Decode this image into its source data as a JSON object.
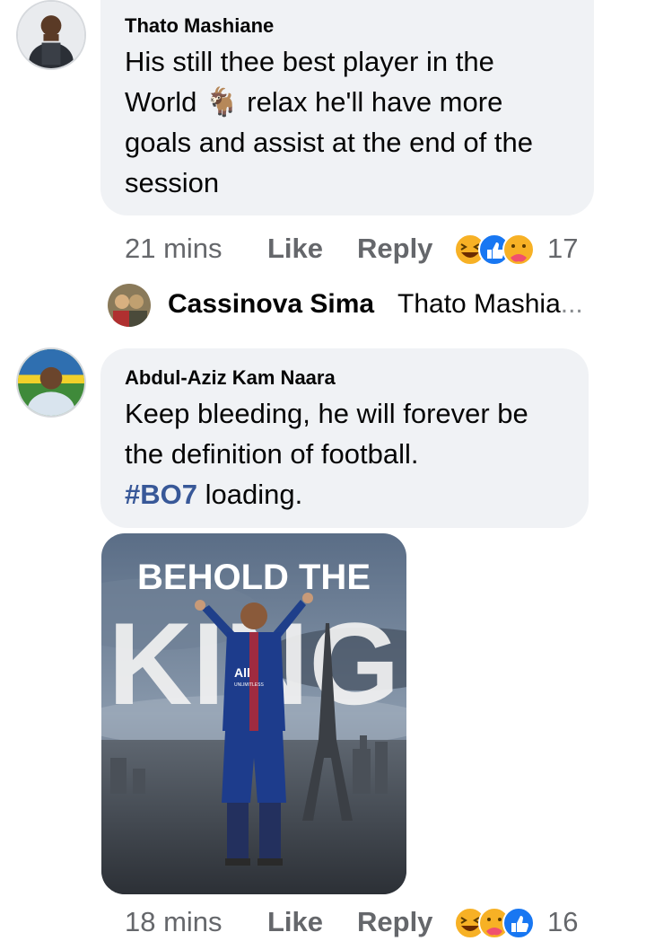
{
  "comments": [
    {
      "author": "Thato Mashiane",
      "text_before_emoji": "His still thee best player in the\nWorld",
      "emoji": "🐐",
      "text_after_emoji": " relax he'll have more\ngoals and assist at the end of the\nsession",
      "time": "21 mins",
      "like_label": "Like",
      "reply_label": "Reply",
      "reaction_count": "17",
      "reactions": [
        "haha",
        "like",
        "care"
      ]
    },
    {
      "author": "Abdul-Aziz Kam Naara",
      "text": " Keep bleeding, he will forever be\nthe definition of football.",
      "hashtag": "#BO7",
      "hashtag_suffix": " loading.",
      "photo": {
        "headline_top": "BEHOLD THE",
        "headline_big": "KING",
        "shirt_text": "All",
        "shirt_sub": "UNLIMITLESS"
      },
      "time": "18 mins",
      "like_label": "Like",
      "reply_label": "Reply",
      "reaction_count": "16",
      "reactions": [
        "haha",
        "care",
        "like"
      ]
    }
  ],
  "reply_preview": {
    "name": "Cassinova Sima",
    "text": "Thato Mashia",
    "ellipsis": "..."
  },
  "colors": {
    "bubble": "#f0f2f5",
    "meta": "#65676b",
    "hashtag": "#385898",
    "like_blue": "#1877f2",
    "haha_yellow": "#f7b125"
  }
}
